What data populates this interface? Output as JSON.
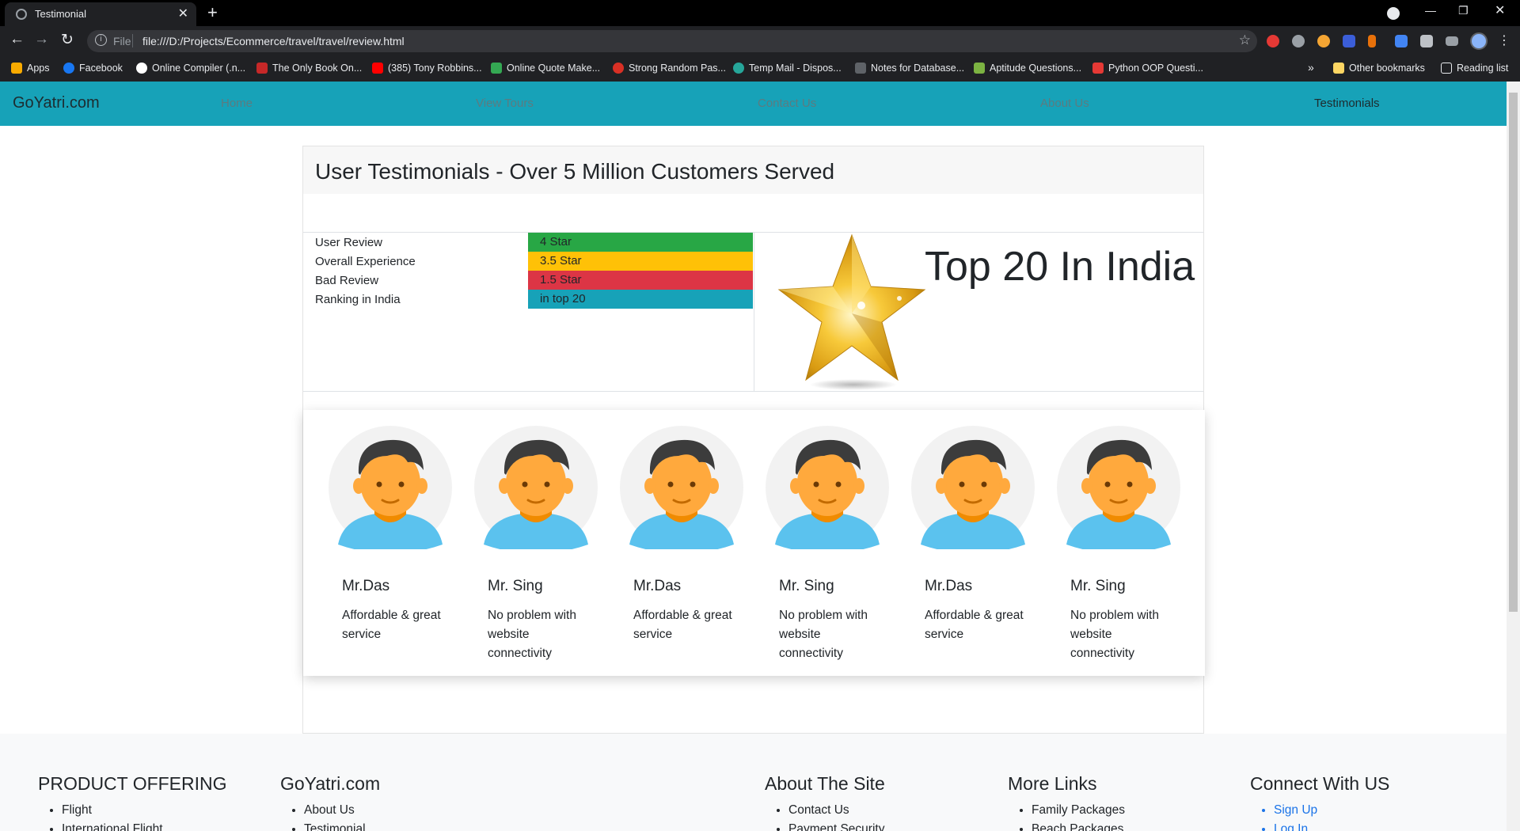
{
  "browser": {
    "tab_title": "Testimonial",
    "url_scheme": "File",
    "url": "file:///D:/Projects/Ecommerce/travel/travel/review.html",
    "bookmarks": [
      "Apps",
      "Facebook",
      "Online Compiler (.n...",
      "The Only Book On...",
      "(385) Tony Robbins...",
      "Online Quote Make...",
      "Strong Random Pas...",
      "Temp Mail - Dispos...",
      "Notes for Database...",
      "Aptitude Questions...",
      "Python OOP Questi..."
    ],
    "bookmark_overflow": "»",
    "other_bookmarks": "Other bookmarks",
    "reading_list": "Reading list"
  },
  "navbar": {
    "brand": "GoYatri.com",
    "links": [
      "Home",
      "View Tours",
      "Contact Us",
      "About Us",
      "Testimonials"
    ],
    "active": "Testimonials"
  },
  "header": {
    "title": "User Testimonials - Over 5 Million Customers Served"
  },
  "stats": [
    {
      "label": "User Review",
      "value": "4 Star",
      "color": "#28a745"
    },
    {
      "label": "Overall Experience",
      "value": "3.5 Star",
      "color": "#ffc107"
    },
    {
      "label": "Bad Review",
      "value": "1.5 Star",
      "color": "#dc3545"
    },
    {
      "label": "Ranking in India",
      "value": "in top 20",
      "color": "#17a2b8"
    }
  ],
  "ranking": {
    "title": "Top 20 In India"
  },
  "reviews": [
    {
      "name": "Mr.Das",
      "comment": "Affordable & great service"
    },
    {
      "name": "Mr. Sing",
      "comment": "No problem with website connectivity"
    },
    {
      "name": "Mr.Das",
      "comment": "Affordable & great service"
    },
    {
      "name": "Mr. Sing",
      "comment": "No problem with website connectivity"
    },
    {
      "name": "Mr.Das",
      "comment": "Affordable & great service"
    },
    {
      "name": "Mr. Sing",
      "comment": "No problem with website connectivity"
    }
  ],
  "footer": {
    "columns": [
      {
        "heading": "PRODUCT OFFERING",
        "items": [
          "Flight",
          "International Flight"
        ]
      },
      {
        "heading": "GoYatri.com",
        "items": [
          "About Us",
          "Testimonial"
        ]
      },
      {
        "heading": "About The Site",
        "items": [
          "Contact Us",
          "Payment Security"
        ]
      },
      {
        "heading": "More Links",
        "items": [
          "Family Packages",
          "Beach Packages"
        ]
      },
      {
        "heading": "Connect With US",
        "items": [
          "Sign Up",
          "Log In"
        ]
      }
    ]
  },
  "colors": {
    "navbar": "#17a2b8",
    "link": "#1a73e8"
  }
}
